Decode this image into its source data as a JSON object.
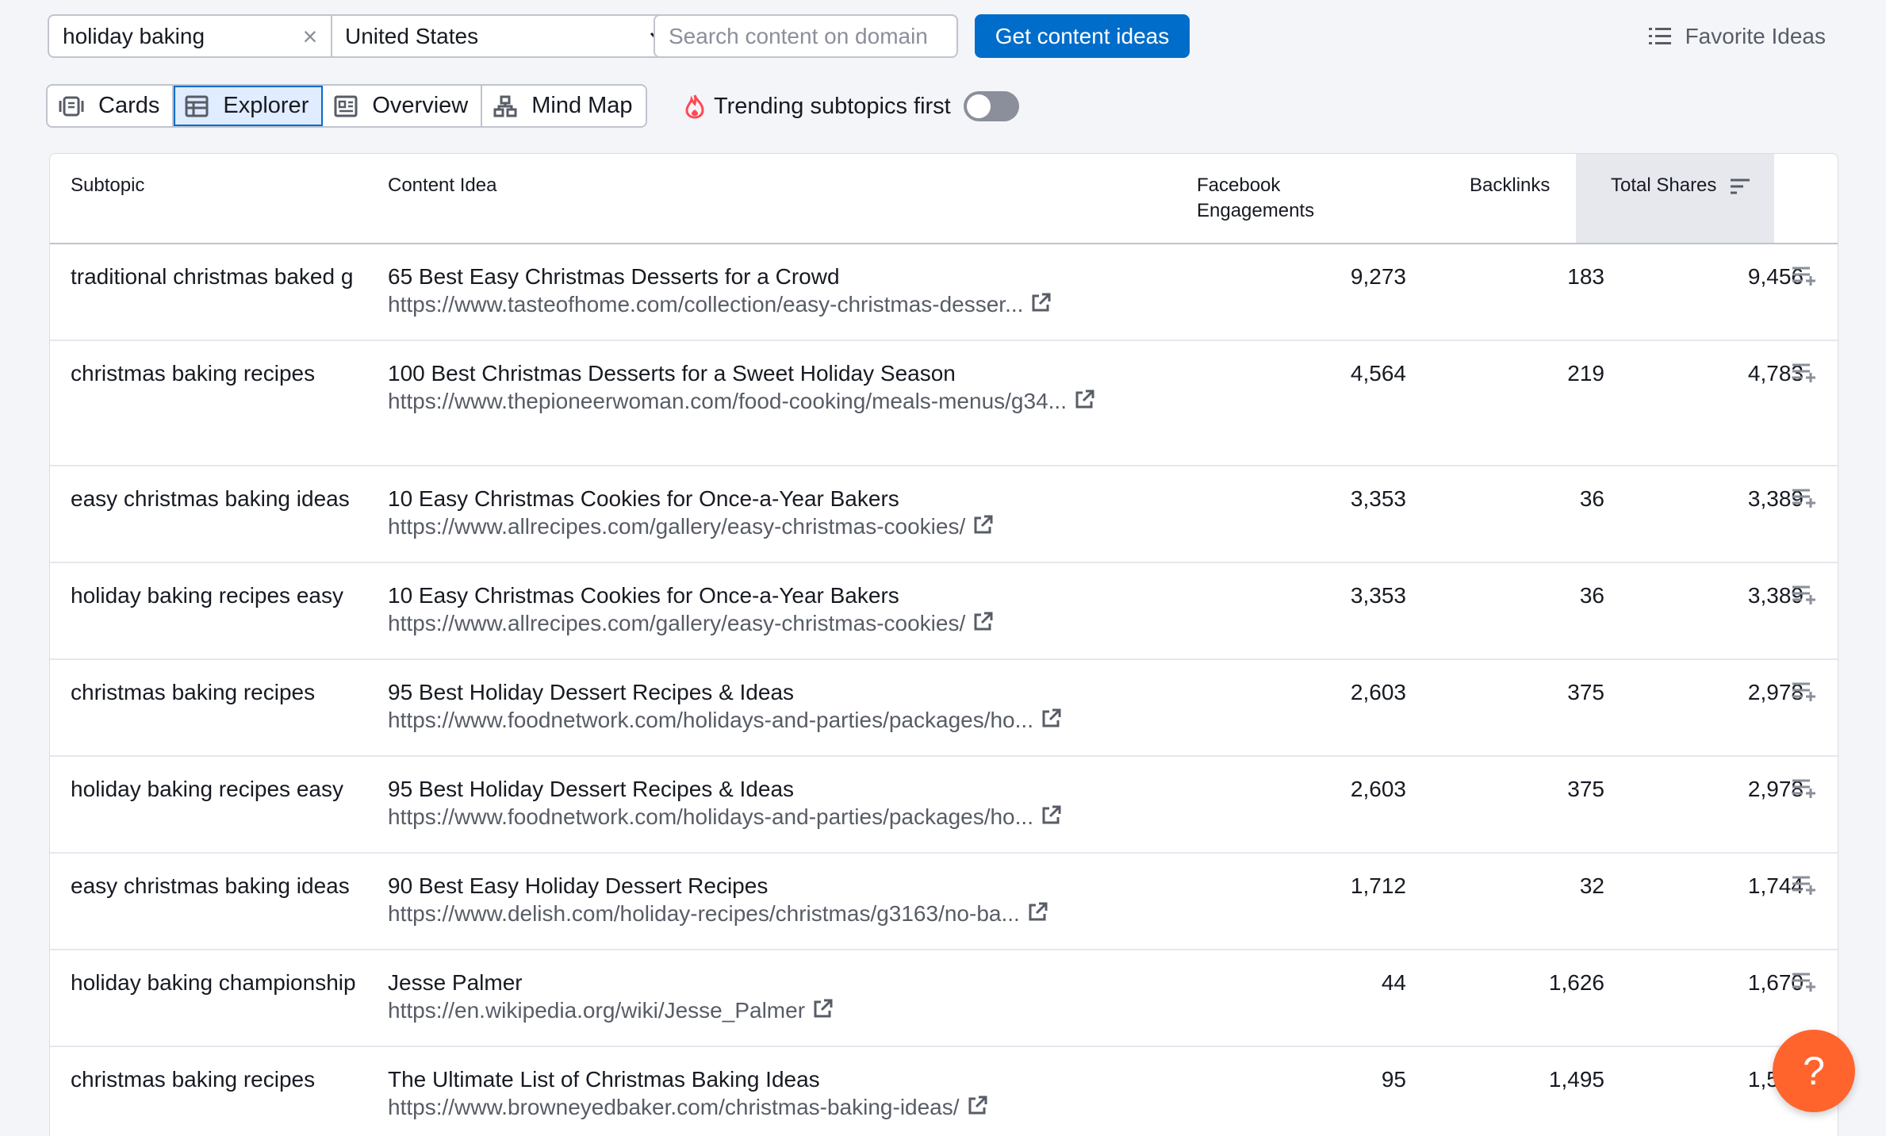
{
  "search": {
    "keyword": "holiday baking",
    "database": "United States",
    "domain_placeholder": "Search content on domain",
    "submit_label": "Get content ideas"
  },
  "favorites_label": "Favorite Ideas",
  "views": {
    "tabs": [
      {
        "label": "Cards",
        "icon": "cards-icon"
      },
      {
        "label": "Explorer",
        "icon": "table-icon",
        "active": true
      },
      {
        "label": "Overview",
        "icon": "overview-icon"
      },
      {
        "label": "Mind Map",
        "icon": "mindmap-icon"
      }
    ],
    "trending_label": "Trending subtopics first",
    "trending_enabled": false
  },
  "table": {
    "columns": {
      "subtopic": "Subtopic",
      "idea": "Content Idea",
      "fb_line1": "Facebook",
      "fb_line2": "Engagements",
      "backlinks": "Backlinks",
      "shares": "Total Shares"
    },
    "sorted_by": "Total Shares",
    "rows": [
      {
        "subtopic": "traditional christmas baked g",
        "title": "65 Best Easy Christmas Desserts for a Crowd",
        "url": "https://www.tasteofhome.com/collection/easy-christmas-desser...",
        "fb": "9,273",
        "backlinks": "183",
        "shares": "9,456"
      },
      {
        "subtopic": "christmas baking recipes",
        "title": "100 Best Christmas Desserts for a Sweet Holiday Season",
        "url": "https://www.thepioneerwoman.com/food-cooking/meals-menus/g34...",
        "fb": "4,564",
        "backlinks": "219",
        "shares": "4,783"
      },
      {
        "subtopic": "easy christmas baking ideas",
        "title": "10 Easy Christmas Cookies for Once-a-Year Bakers",
        "url": "https://www.allrecipes.com/gallery/easy-christmas-cookies/",
        "fb": "3,353",
        "backlinks": "36",
        "shares": "3,389"
      },
      {
        "subtopic": "holiday baking recipes easy",
        "title": "10 Easy Christmas Cookies for Once-a-Year Bakers",
        "url": "https://www.allrecipes.com/gallery/easy-christmas-cookies/",
        "fb": "3,353",
        "backlinks": "36",
        "shares": "3,389"
      },
      {
        "subtopic": "christmas baking recipes",
        "title": "95 Best Holiday Dessert Recipes & Ideas",
        "url": "https://www.foodnetwork.com/holidays-and-parties/packages/ho...",
        "fb": "2,603",
        "backlinks": "375",
        "shares": "2,978"
      },
      {
        "subtopic": "holiday baking recipes easy",
        "title": "95 Best Holiday Dessert Recipes & Ideas",
        "url": "https://www.foodnetwork.com/holidays-and-parties/packages/ho...",
        "fb": "2,603",
        "backlinks": "375",
        "shares": "2,978"
      },
      {
        "subtopic": "easy christmas baking ideas",
        "title": "90 Best Easy Holiday Dessert Recipes",
        "url": "https://www.delish.com/holiday-recipes/christmas/g3163/no-ba...",
        "fb": "1,712",
        "backlinks": "32",
        "shares": "1,744"
      },
      {
        "subtopic": "holiday baking championship",
        "title": "Jesse Palmer",
        "url": "https://en.wikipedia.org/wiki/Jesse_Palmer",
        "fb": "44",
        "backlinks": "1,626",
        "shares": "1,670"
      },
      {
        "subtopic": "christmas baking recipes",
        "title": "The Ultimate List of Christmas Baking Ideas",
        "url": "https://www.browneyedbaker.com/christmas-baking-ideas/",
        "fb": "95",
        "backlinks": "1,495",
        "shares": "1,590"
      }
    ]
  },
  "help_label": "?",
  "colors": {
    "primary": "#006dca",
    "help": "#ff642d",
    "fire": "#ff4953"
  }
}
